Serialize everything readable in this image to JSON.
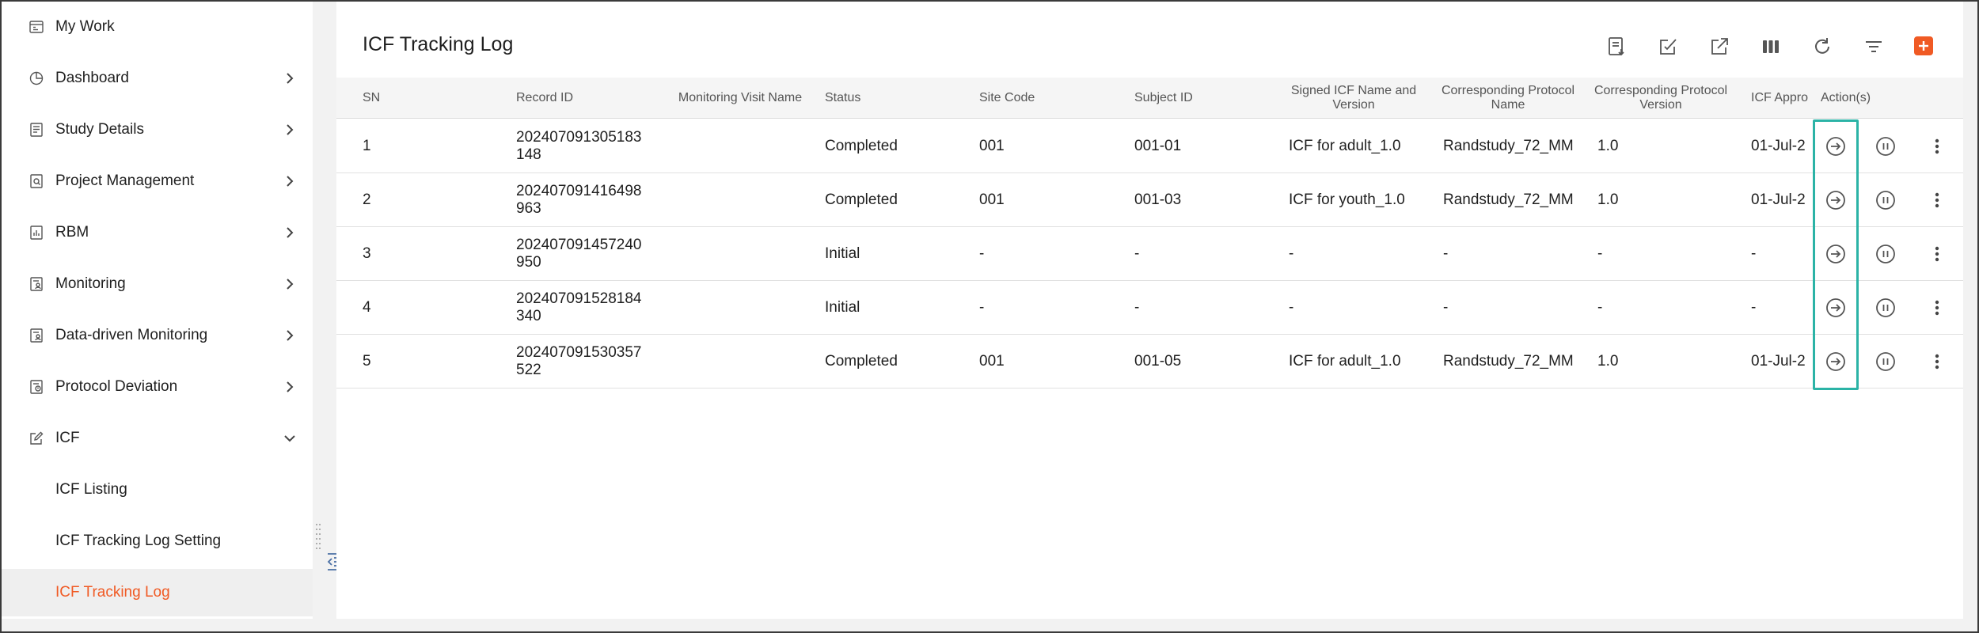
{
  "sidebar": {
    "items": [
      {
        "label": "My Work",
        "icon": "calendar-icon",
        "chevron": "none"
      },
      {
        "label": "Dashboard",
        "icon": "chart-pie-icon",
        "chevron": "right"
      },
      {
        "label": "Study Details",
        "icon": "document-list-icon",
        "chevron": "right"
      },
      {
        "label": "Project Management",
        "icon": "document-search-icon",
        "chevron": "right"
      },
      {
        "label": "RBM",
        "icon": "document-chart-icon",
        "chevron": "right"
      },
      {
        "label": "Monitoring",
        "icon": "document-user-icon",
        "chevron": "right"
      },
      {
        "label": "Data-driven Monitoring",
        "icon": "document-user-icon",
        "chevron": "right"
      },
      {
        "label": "Protocol Deviation",
        "icon": "document-alert-icon",
        "chevron": "right"
      },
      {
        "label": "ICF",
        "icon": "edit-icon",
        "chevron": "down"
      }
    ],
    "sub_items": [
      {
        "label": "ICF Listing"
      },
      {
        "label": "ICF Tracking Log Setting"
      },
      {
        "label": "ICF Tracking Log",
        "active": true
      }
    ]
  },
  "header": {
    "title": "ICF Tracking Log",
    "toolbar": [
      "export-icon",
      "batch-edit-icon",
      "open-external-icon",
      "columns-icon",
      "refresh-icon",
      "filter-icon",
      "add-icon"
    ]
  },
  "table": {
    "columns": [
      "SN",
      "Record ID",
      "Monitoring Visit Name",
      "Status",
      "Site Code",
      "Subject ID",
      "Signed ICF Name and Version",
      "Corresponding Protocol Name",
      "Corresponding Protocol Version",
      "ICF Appro",
      "Action(s)"
    ],
    "rows": [
      {
        "sn": "1",
        "record_id_1": "202407091305183",
        "record_id_2": "148",
        "visit": "",
        "status": "Completed",
        "site": "001",
        "subject": "001-01",
        "icf": "ICF for adult_1.0",
        "protocol": "Randstudy_72_MM",
        "version": "1.0",
        "approval": "01-Jul-2"
      },
      {
        "sn": "2",
        "record_id_1": "202407091416498",
        "record_id_2": "963",
        "visit": "",
        "status": "Completed",
        "site": "001",
        "subject": "001-03",
        "icf": "ICF for youth_1.0",
        "protocol": "Randstudy_72_MM",
        "version": "1.0",
        "approval": "01-Jul-2"
      },
      {
        "sn": "3",
        "record_id_1": "202407091457240",
        "record_id_2": "950",
        "visit": "",
        "status": "Initial",
        "site": "-",
        "subject": "-",
        "icf": "-",
        "protocol": "-",
        "version": "-",
        "approval": "-"
      },
      {
        "sn": "4",
        "record_id_1": "202407091528184",
        "record_id_2": "340",
        "visit": "",
        "status": "Initial",
        "site": "-",
        "subject": "-",
        "icf": "-",
        "protocol": "-",
        "version": "-",
        "approval": "-"
      },
      {
        "sn": "5",
        "record_id_1": "202407091530357",
        "record_id_2": "522",
        "visit": "",
        "status": "Completed",
        "site": "001",
        "subject": "001-05",
        "icf": "ICF for adult_1.0",
        "protocol": "Randstudy_72_MM",
        "version": "1.0",
        "approval": "01-Jul-2"
      }
    ],
    "row_actions": [
      "arrow-right-circle-icon",
      "pause-circle-icon",
      "more-vertical-icon"
    ]
  },
  "colors": {
    "accent": "#f05a24",
    "highlight": "#2bb3a6"
  }
}
